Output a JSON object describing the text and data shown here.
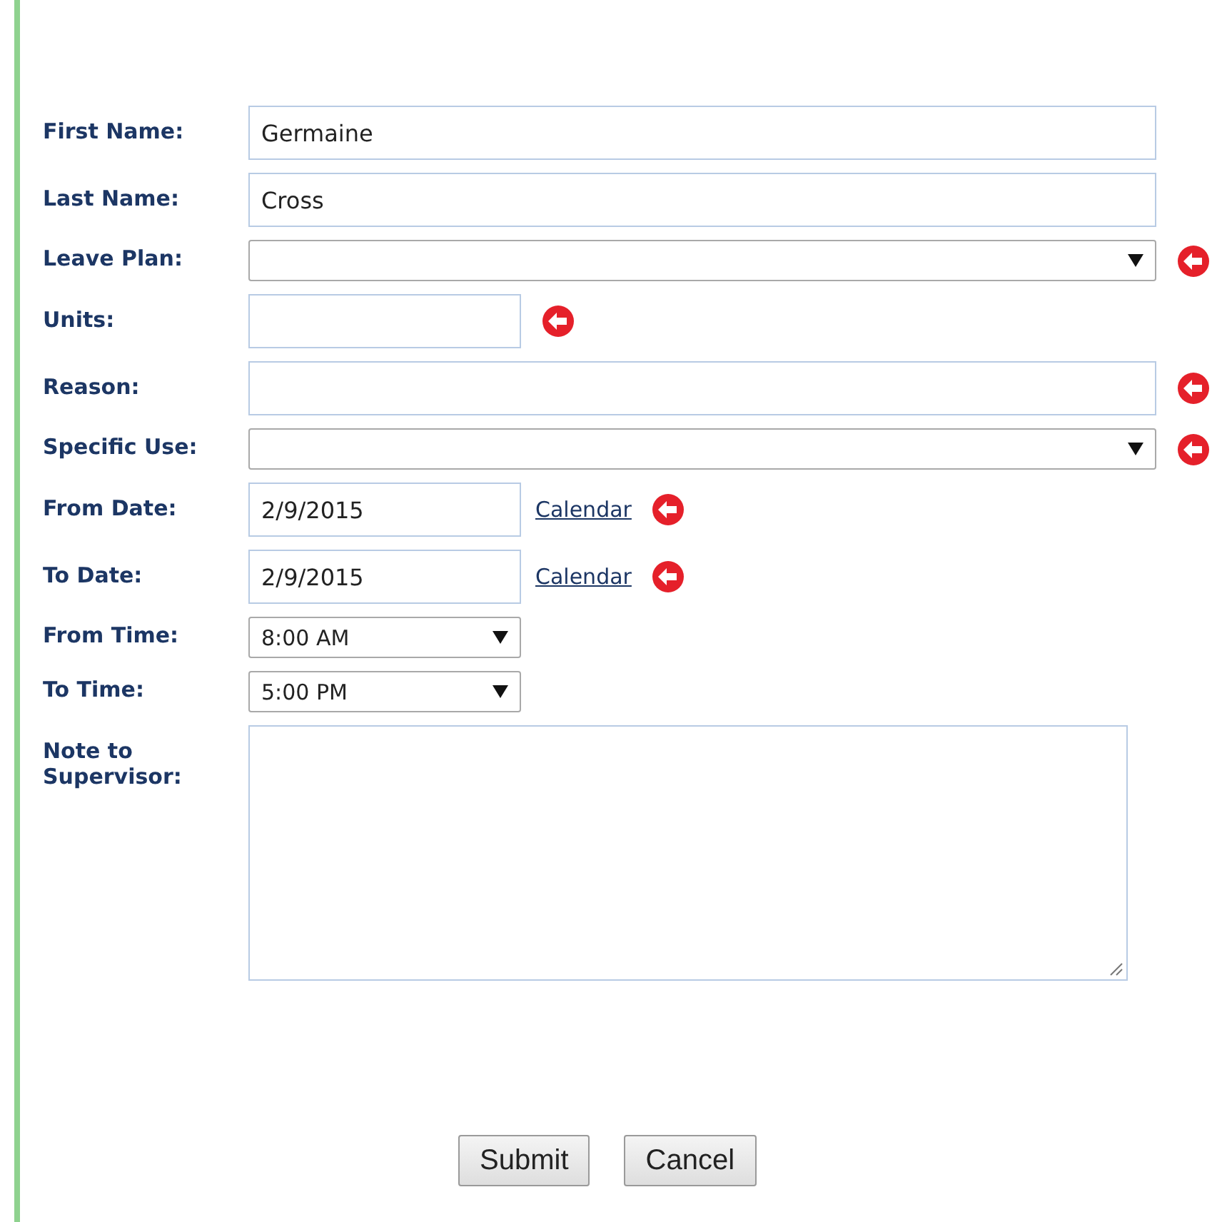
{
  "form": {
    "fields": [
      {
        "label": "First Name:",
        "kind": "text",
        "value": "Germaine",
        "required": false
      },
      {
        "label": "Last Name:",
        "kind": "text",
        "value": "Cross",
        "required": false
      },
      {
        "label": "Leave Plan:",
        "kind": "select",
        "required": true
      },
      {
        "label": "Units:",
        "kind": "short",
        "required": true
      },
      {
        "label": "Reason:",
        "kind": "text",
        "required": true
      },
      {
        "label": "Specific Use:",
        "kind": "select",
        "required": true
      },
      {
        "label": "From Date:",
        "kind": "date",
        "value": "2/9/2015",
        "link": "Calendar",
        "required": true
      },
      {
        "label": "To Date:",
        "kind": "date",
        "value": "2/9/2015",
        "link": "Calendar",
        "required": true
      },
      {
        "label": "From Time:",
        "kind": "time",
        "value": "8:00 AM",
        "required": false
      },
      {
        "label": "To Time:",
        "kind": "time",
        "value": "5:00 PM",
        "required": false
      },
      {
        "label": "Note to Supervisor:",
        "kind": "textarea",
        "required": false
      }
    ]
  },
  "buttons": [
    "Submit",
    "Cancel"
  ]
}
